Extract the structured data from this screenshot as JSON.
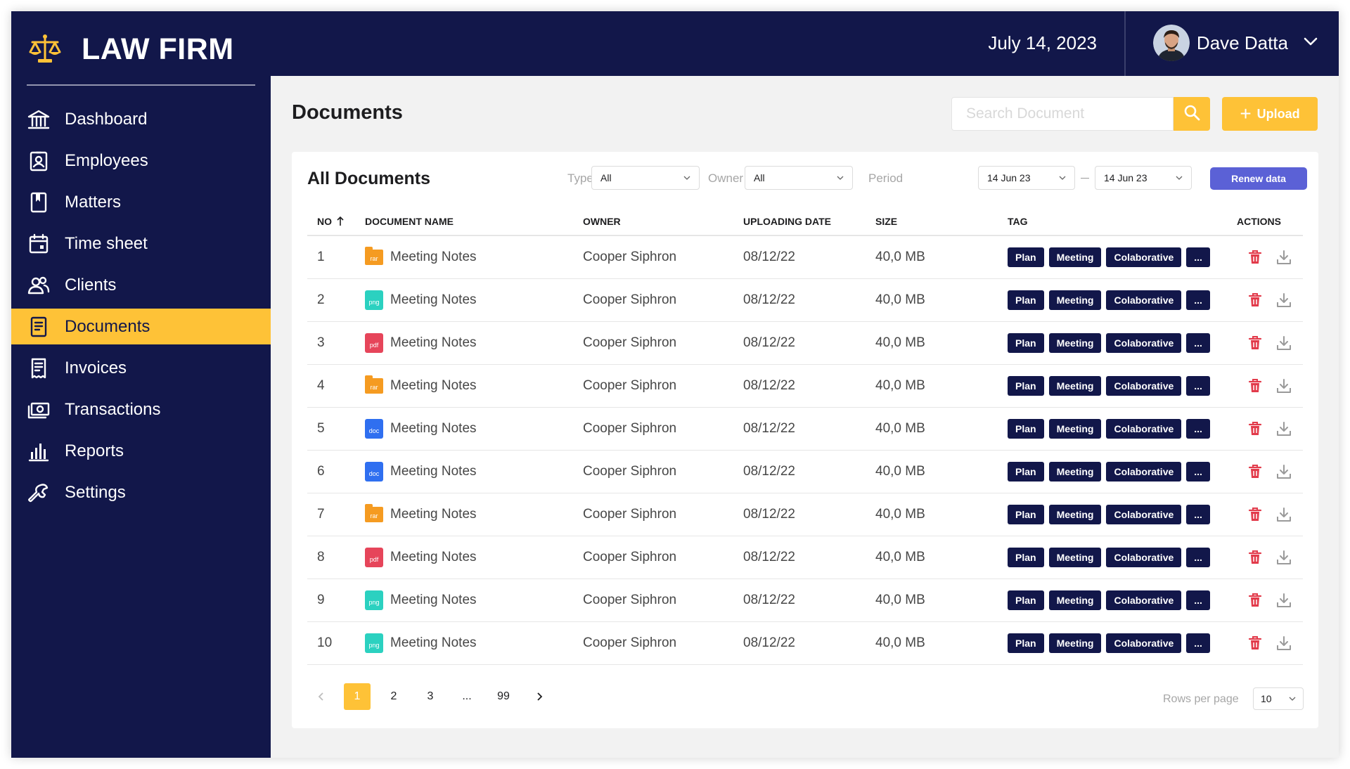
{
  "brand": {
    "name": "LAW FIRM",
    "icon": "scales-icon",
    "accent": "#fec237"
  },
  "sidebar": {
    "items": [
      {
        "label": "Dashboard",
        "icon": "bank-icon",
        "active": false
      },
      {
        "label": "Employees",
        "icon": "id-badge-icon",
        "active": false
      },
      {
        "label": "Matters",
        "icon": "bookmark-icon",
        "active": false
      },
      {
        "label": "Time sheet",
        "icon": "calendar-icon",
        "active": false
      },
      {
        "label": "Clients",
        "icon": "users-icon",
        "active": false
      },
      {
        "label": "Documents",
        "icon": "document-icon",
        "active": true
      },
      {
        "label": "Invoices",
        "icon": "invoice-icon",
        "active": false
      },
      {
        "label": "Transactions",
        "icon": "money-icon",
        "active": false
      },
      {
        "label": "Reports",
        "icon": "bar-chart-icon",
        "active": false
      },
      {
        "label": "Settings",
        "icon": "wrench-icon",
        "active": false
      }
    ]
  },
  "header": {
    "date": "July 14, 2023",
    "user_name": "Dave Datta"
  },
  "page": {
    "title": "Documents",
    "search_placeholder": "Search Document",
    "upload_label": "Upload"
  },
  "card": {
    "title": "All Documents",
    "filters": {
      "type_label": "Type",
      "type_value": "All",
      "owner_label": "Owner",
      "owner_value": "All",
      "period_label": "Period",
      "period_from": "14 Jun 23",
      "period_to": "14 Jun 23",
      "renew_label": "Renew data"
    },
    "columns": {
      "no": "NO",
      "name": "DOCUMENT NAME",
      "owner": "OWNER",
      "date": "UPLOADING DATE",
      "size": "SIZE",
      "tag": "TAG",
      "actions": "ACTIONS"
    },
    "rows": [
      {
        "no": "1",
        "type": "rar",
        "name": "Meeting Notes",
        "owner": "Cooper Siphron",
        "date": "08/12/22",
        "size": "40,0 MB",
        "tags": [
          "Plan",
          "Meeting",
          "Colaborative",
          "..."
        ]
      },
      {
        "no": "2",
        "type": "png",
        "name": "Meeting Notes",
        "owner": "Cooper Siphron",
        "date": "08/12/22",
        "size": "40,0 MB",
        "tags": [
          "Plan",
          "Meeting",
          "Colaborative",
          "..."
        ]
      },
      {
        "no": "3",
        "type": "pdf",
        "name": "Meeting Notes",
        "owner": "Cooper Siphron",
        "date": "08/12/22",
        "size": "40,0 MB",
        "tags": [
          "Plan",
          "Meeting",
          "Colaborative",
          "..."
        ]
      },
      {
        "no": "4",
        "type": "rar",
        "name": "Meeting Notes",
        "owner": "Cooper Siphron",
        "date": "08/12/22",
        "size": "40,0 MB",
        "tags": [
          "Plan",
          "Meeting",
          "Colaborative",
          "..."
        ]
      },
      {
        "no": "5",
        "type": "doc",
        "name": "Meeting Notes",
        "owner": "Cooper Siphron",
        "date": "08/12/22",
        "size": "40,0 MB",
        "tags": [
          "Plan",
          "Meeting",
          "Colaborative",
          "..."
        ]
      },
      {
        "no": "6",
        "type": "doc",
        "name": "Meeting Notes",
        "owner": "Cooper Siphron",
        "date": "08/12/22",
        "size": "40,0 MB",
        "tags": [
          "Plan",
          "Meeting",
          "Colaborative",
          "..."
        ]
      },
      {
        "no": "7",
        "type": "rar",
        "name": "Meeting Notes",
        "owner": "Cooper Siphron",
        "date": "08/12/22",
        "size": "40,0 MB",
        "tags": [
          "Plan",
          "Meeting",
          "Colaborative",
          "..."
        ]
      },
      {
        "no": "8",
        "type": "pdf",
        "name": "Meeting Notes",
        "owner": "Cooper Siphron",
        "date": "08/12/22",
        "size": "40,0 MB",
        "tags": [
          "Plan",
          "Meeting",
          "Colaborative",
          "..."
        ]
      },
      {
        "no": "9",
        "type": "png",
        "name": "Meeting Notes",
        "owner": "Cooper Siphron",
        "date": "08/12/22",
        "size": "40,0 MB",
        "tags": [
          "Plan",
          "Meeting",
          "Colaborative",
          "..."
        ]
      },
      {
        "no": "10",
        "type": "png",
        "name": "Meeting Notes",
        "owner": "Cooper Siphron",
        "date": "08/12/22",
        "size": "40,0 MB",
        "tags": [
          "Plan",
          "Meeting",
          "Colaborative",
          "..."
        ]
      }
    ],
    "file_type_colors": {
      "rar": "#f59b21",
      "png": "#2bd1c0",
      "pdf": "#e6455a",
      "doc": "#2f6ff0"
    },
    "pagination": {
      "pages": [
        "1",
        "2",
        "3",
        "...",
        "99"
      ],
      "current": "1"
    },
    "rows_per_page_label": "Rows per page",
    "rows_per_page_value": "10"
  }
}
